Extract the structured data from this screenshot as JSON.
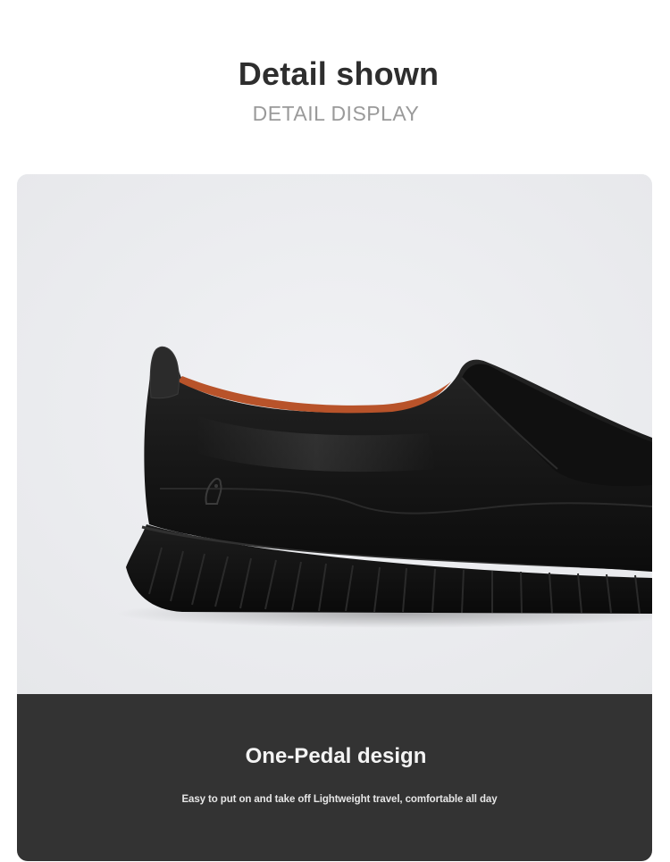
{
  "header": {
    "title": "Detail shown",
    "subtitle": "DETAIL DISPLAY"
  },
  "product_image": {
    "subject": "black leather slip-on loafer shoe, side view",
    "background_color": "#ECEDF0",
    "upper_color": "#151515",
    "lining_color": "#B8532A",
    "sole_color": "#121212"
  },
  "feature": {
    "title": "One-Pedal design",
    "description": "Easy to put on and take off Lightweight travel, comfortable all day",
    "panel_color": "#333333"
  }
}
